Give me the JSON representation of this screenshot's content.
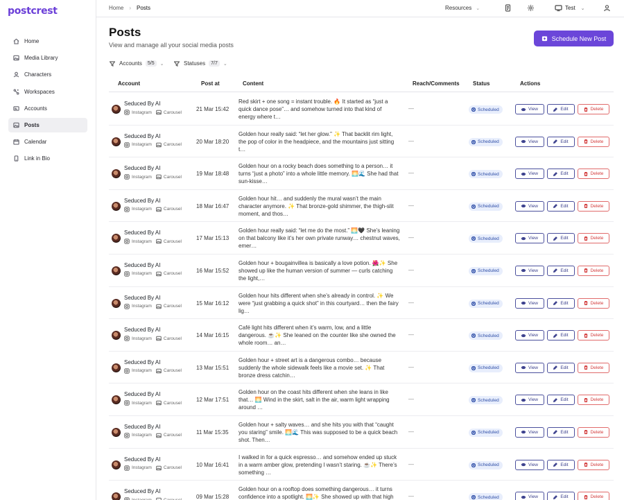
{
  "app": {
    "logo": "postcrest"
  },
  "sidebar": {
    "items": [
      {
        "label": "Home",
        "icon": "home-icon"
      },
      {
        "label": "Media Library",
        "icon": "image-icon"
      },
      {
        "label": "Characters",
        "icon": "user-icon"
      },
      {
        "label": "Workspaces",
        "icon": "workspaces-icon"
      },
      {
        "label": "Accounts",
        "icon": "accounts-icon"
      },
      {
        "label": "Posts",
        "icon": "posts-icon",
        "active": true
      },
      {
        "label": "Calendar",
        "icon": "calendar-icon"
      },
      {
        "label": "Link in Bio",
        "icon": "phone-icon"
      }
    ]
  },
  "topbar": {
    "breadcrumb": {
      "home": "Home",
      "current": "Posts"
    },
    "resources": "Resources",
    "user": "Test"
  },
  "page": {
    "title": "Posts",
    "subtitle": "View and manage all your social media posts",
    "schedule_button": "Schedule New Post"
  },
  "filters": {
    "accounts": {
      "label": "Accounts",
      "count": "5/5"
    },
    "statuses": {
      "label": "Statuses",
      "count": "7/7"
    }
  },
  "table": {
    "headers": {
      "account": "Account",
      "post_at": "Post at",
      "content": "Content",
      "reach": "Reach/Comments",
      "status": "Status",
      "actions": "Actions"
    },
    "labels": {
      "view": "View",
      "edit": "Edit",
      "delete": "Delete"
    },
    "rows": [
      {
        "account": "Seduced By AI",
        "platform": "Instagram",
        "format": "Carousel",
        "post_at": "21 Mar 15:42",
        "content": "Red skirt + one song = instant trouble. 🔥 It started as “just a quick dance pose”… and somehow turned into that kind of energy where t…",
        "reach": "—",
        "status": "Scheduled"
      },
      {
        "account": "Seduced By AI",
        "platform": "Instagram",
        "format": "Carousel",
        "post_at": "20 Mar 18:20",
        "content": "Golden hour really said: “let her glow.” ✨ That backlit rim light, the pop of color in the headpiece, and the mountains just sitting t…",
        "reach": "—",
        "status": "Scheduled"
      },
      {
        "account": "Seduced By AI",
        "platform": "Instagram",
        "format": "Carousel",
        "post_at": "19 Mar 18:48",
        "content": "Golden hour on a rocky beach does something to a person… it turns “just a photo” into a whole little memory. 🌅🌊 She had that sun-kisse…",
        "reach": "—",
        "status": "Scheduled"
      },
      {
        "account": "Seduced By AI",
        "platform": "Instagram",
        "format": "Carousel",
        "post_at": "18 Mar 16:47",
        "content": "Golden hour hit… and suddenly the mural wasn’t the main character anymore. ✨ That bronze-gold shimmer, the thigh-slit moment, and thos…",
        "reach": "—",
        "status": "Scheduled"
      },
      {
        "account": "Seduced By AI",
        "platform": "Instagram",
        "format": "Carousel",
        "post_at": "17 Mar 15:13",
        "content": "Golden hour really said: “let me do the most.” 🌅🖤 She’s leaning on that balcony like it’s her own private runway… chestnut waves, emer…",
        "reach": "—",
        "status": "Scheduled"
      },
      {
        "account": "Seduced By AI",
        "platform": "Instagram",
        "format": "Carousel",
        "post_at": "16 Mar 15:52",
        "content": "Golden hour + bougainvillea is basically a love potion. 🌺✨ She showed up like the human version of summer — curls catching the light,…",
        "reach": "—",
        "status": "Scheduled"
      },
      {
        "account": "Seduced By AI",
        "platform": "Instagram",
        "format": "Carousel",
        "post_at": "15 Mar 16:12",
        "content": "Golden hour hits different when she’s already in control. ✨ We were “just grabbing a quick shot” in this courtyard… then the fairy lig…",
        "reach": "—",
        "status": "Scheduled"
      },
      {
        "account": "Seduced By AI",
        "platform": "Instagram",
        "format": "Carousel",
        "post_at": "14 Mar 16:15",
        "content": "Café light hits different when it’s warm, low, and a little dangerous. ☕✨ She leaned on the counter like she owned the whole room… an…",
        "reach": "—",
        "status": "Scheduled"
      },
      {
        "account": "Seduced By AI",
        "platform": "Instagram",
        "format": "Carousel",
        "post_at": "13 Mar 15:51",
        "content": "Golden hour + street art is a dangerous combo… because suddenly the whole sidewalk feels like a movie set. ✨ That bronze dress catchin…",
        "reach": "—",
        "status": "Scheduled"
      },
      {
        "account": "Seduced By AI",
        "platform": "Instagram",
        "format": "Carousel",
        "post_at": "12 Mar 17:51",
        "content": "Golden hour on the coast hits different when she leans in like that… 🌅 Wind in the skirt, salt in the air, warm light wrapping around …",
        "reach": "—",
        "status": "Scheduled"
      },
      {
        "account": "Seduced By AI",
        "platform": "Instagram",
        "format": "Carousel",
        "post_at": "11 Mar 15:35",
        "content": "Golden hour + salty waves… and she hits you with that “caught you staring” smile. 🌅🌊 This was supposed to be a quick beach shot. Then…",
        "reach": "—",
        "status": "Scheduled"
      },
      {
        "account": "Seduced By AI",
        "platform": "Instagram",
        "format": "Carousel",
        "post_at": "10 Mar 16:41",
        "content": "I walked in for a quick espresso… and somehow ended up stuck in a warm amber glow, pretending I wasn’t staring. ☕✨ There’s something …",
        "reach": "—",
        "status": "Scheduled"
      },
      {
        "account": "Seduced By AI",
        "platform": "Instagram",
        "format": "Carousel",
        "post_at": "09 Mar 15:28",
        "content": "Golden hour on a rooftop does something dangerous… it turns confidence into a spotlight. 🌅✨ She showed up with that high",
        "reach": "—",
        "status": "Scheduled"
      }
    ]
  }
}
